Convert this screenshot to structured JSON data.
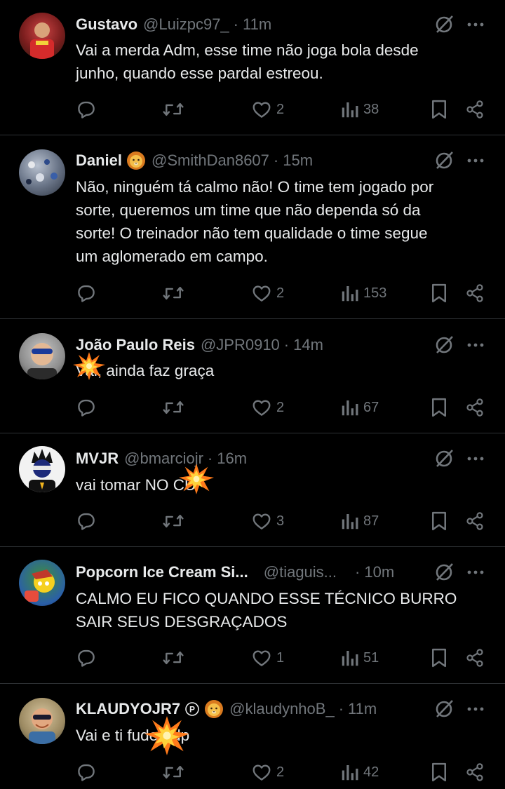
{
  "tweets": [
    {
      "name": "Gustavo",
      "handle": "@Luizpc97_",
      "time": "11m",
      "text": "Vai a merda Adm, esse time não joga bola desde\njunho, quando esse pardal estreou.",
      "likes": "2",
      "views": "38"
    },
    {
      "name": "Daniel",
      "badge_icon": "lion-emoji",
      "handle": "@SmithDan8607",
      "time": "15m",
      "text": "Não, ninguém tá calmo não! O time tem jogado por\nsorte, queremos um time que não dependa só da\nsorte! O treinador não tem qualidade o time segue\num aglomerado em campo.",
      "likes": "2",
      "views": "153"
    },
    {
      "name": "João Paulo Reis",
      "handle": "@JPR0910",
      "time": "14m",
      "text": "Vai, ainda faz graça",
      "likes": "2",
      "views": "67"
    },
    {
      "name": "MVJR",
      "handle": "@bmarciojr",
      "time": "16m",
      "text": "vai tomar NO CU",
      "likes": "3",
      "views": "87"
    },
    {
      "name": "Popcorn Ice Cream Si...",
      "handle": "@tiaguis...",
      "time": "10m",
      "text": "CALMO EU FICO QUANDO ESSE TÉCNICO BURRO\nSAIR SEUS DESGRAÇADOS",
      "likes": "1",
      "views": "51"
    },
    {
      "name": "KLAUDYOJR7",
      "badge_icon": "lion-emoji",
      "handle": "@klaudynhoB_",
      "time": "11m",
      "text": "Vai e ti fuder fdp",
      "likes": "2",
      "views": "42"
    }
  ],
  "colors": {
    "background": "#000000",
    "text": "#e7e9ea",
    "muted": "#71767b",
    "divider": "#2f3336",
    "censor_burst": "#ff9f1c"
  },
  "icons": [
    "reply-icon",
    "retweet-icon",
    "like-icon",
    "views-icon",
    "bookmark-icon",
    "share-icon",
    "grok-icon",
    "more-icon",
    "explosion-emoji"
  ]
}
